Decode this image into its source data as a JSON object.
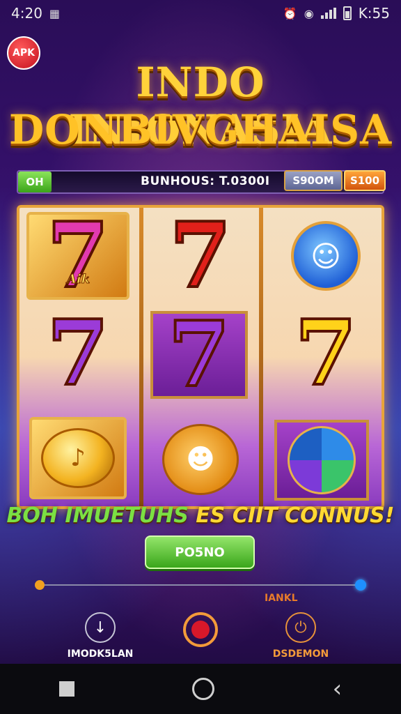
{
  "status_bar": {
    "time_left": "4:20",
    "time_right": "K:55"
  },
  "badge": {
    "apk": "APK"
  },
  "title": {
    "line1": "INDO INIONASIA",
    "line2": "DONBIVGHAISA"
  },
  "info_bar": {
    "left_button": "OH",
    "bonus_label": "BUNHOUS: T.0300I",
    "pill1": "S90OM",
    "pill2": "S100"
  },
  "reels": {
    "r1c1_badge": "Aik"
  },
  "banner": {
    "part1": "BOH IMUETUHS",
    "part2": "ES CIIT CONNUS!"
  },
  "spin_button": {
    "label": "PO5NO"
  },
  "slider": {
    "label": "IANKL"
  },
  "controls": {
    "left_label": "IMODK5LAN",
    "right_label": "DSDEMON"
  },
  "colors": {
    "accent": "#ffd23a",
    "spin": "#3aa61b",
    "frame": "#e8a43a"
  }
}
